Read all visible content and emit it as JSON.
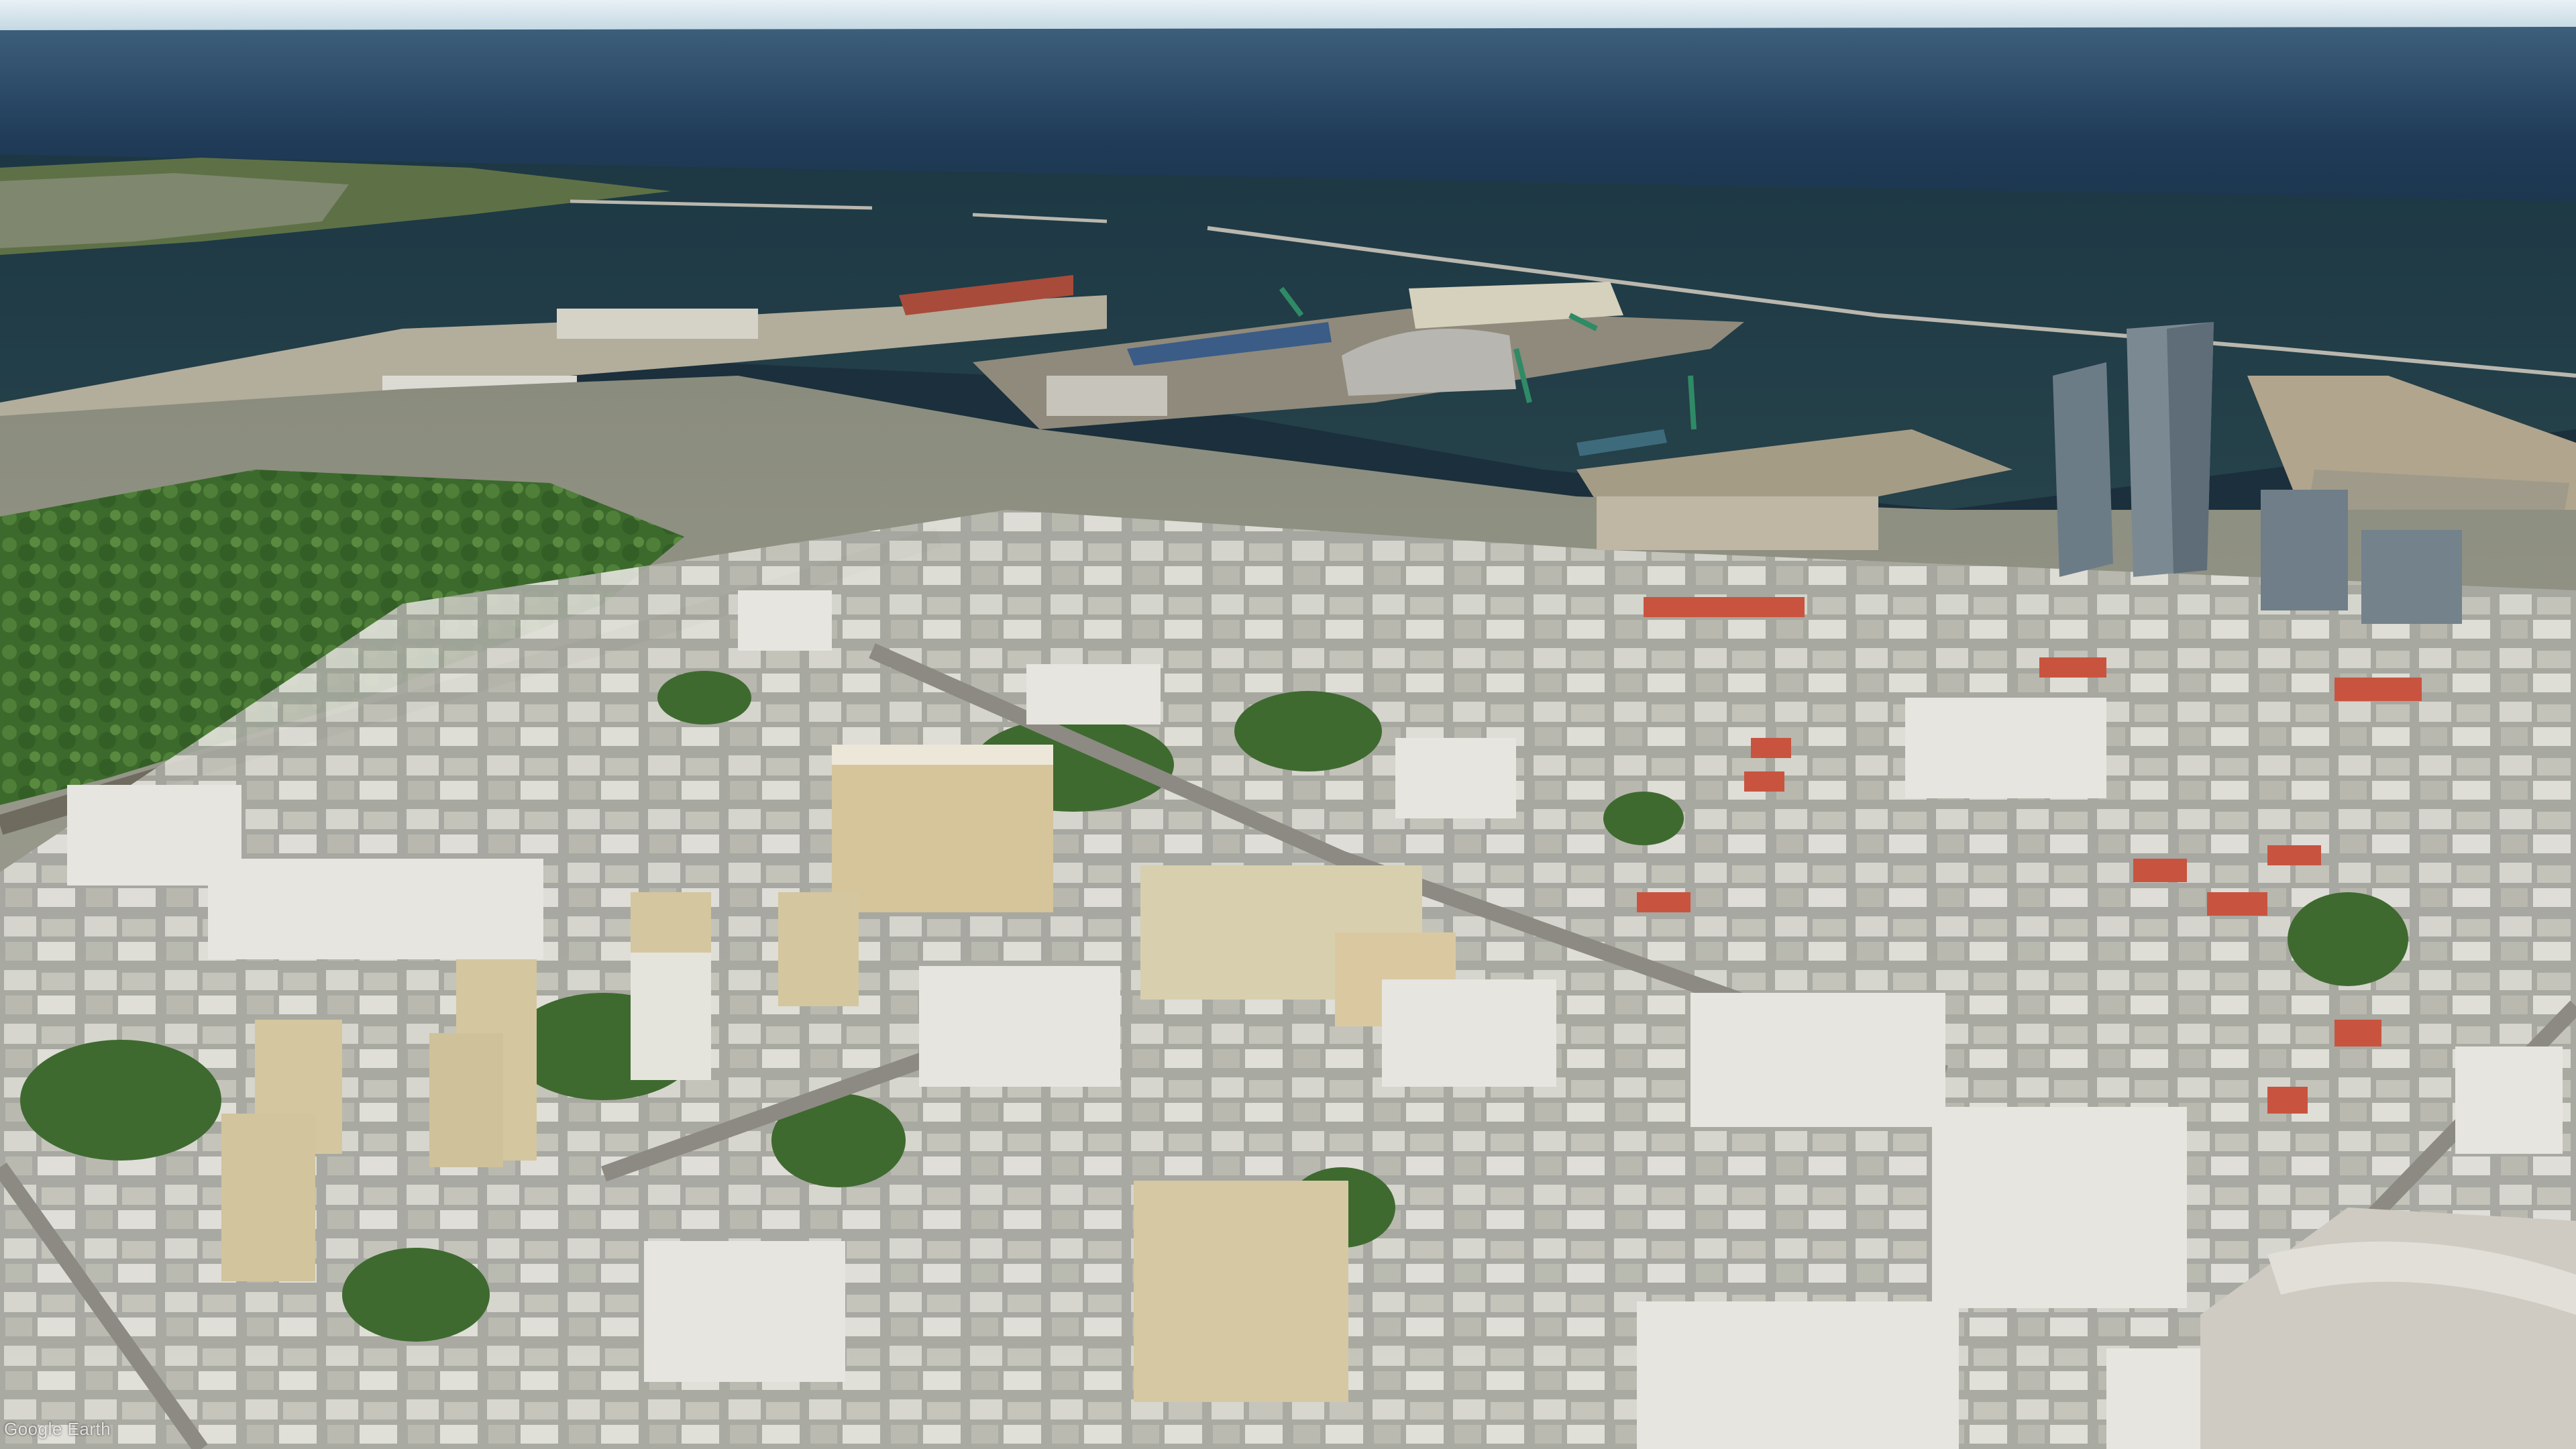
{
  "attribution": {
    "text": "Google Earth"
  },
  "colors": {
    "sky": "#d6e6ee",
    "open_sea": "#1e3a57",
    "harbour_water": "#1f3a44",
    "land": "#9a9a86",
    "park_green": "#3f6b2f",
    "rooftop_light": "#e2e2dc",
    "rooftop_gray": "#a8a8a6",
    "roof_red": "#c84b3a",
    "facade_yellow": "#d8c9a2",
    "glass_tower": "#6d7b86"
  },
  "icons": {
    "map_scene": "aerial-3d-city-view"
  }
}
